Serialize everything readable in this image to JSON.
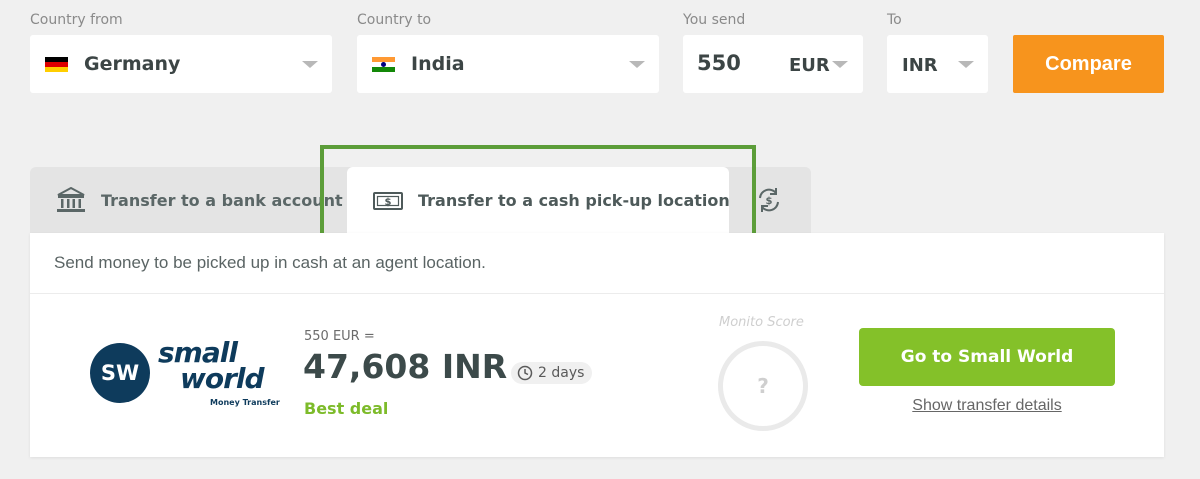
{
  "form": {
    "country_from": {
      "label": "Country from",
      "value": "Germany",
      "flag": "germany-flag"
    },
    "country_to": {
      "label": "Country to",
      "value": "India",
      "flag": "india-flag"
    },
    "you_send": {
      "label": "You send",
      "amount": "550",
      "currency": "EUR"
    },
    "to": {
      "label": "To",
      "currency": "INR"
    },
    "compare_label": "Compare"
  },
  "tabs": [
    {
      "label": "Transfer to a bank account",
      "icon": "bank-icon",
      "selected": false
    },
    {
      "label": "Transfer to a cash pick-up location",
      "icon": "cash-icon",
      "selected": true
    },
    {
      "label": "",
      "icon": "currency-exchange-icon",
      "selected": false
    }
  ],
  "panel": {
    "description": "Send money to be picked up in cash at an agent location."
  },
  "result": {
    "provider": {
      "logo_initials": "SW",
      "logo_line1": "small",
      "logo_line2": "world",
      "logo_sub": "Money Transfer"
    },
    "send_equals": "550 EUR =",
    "receive_amount": "47,608 INR",
    "eta": "2 days",
    "badge": "Best deal",
    "score_label": "Monito Score",
    "score_value": "?",
    "cta_label": "Go to Small World",
    "details_label": "Show transfer details"
  },
  "colors": {
    "accent_orange": "#f7941d",
    "accent_green": "#84c129",
    "highlight_border": "#5c9d39",
    "brand_navy": "#0e3b5c"
  }
}
